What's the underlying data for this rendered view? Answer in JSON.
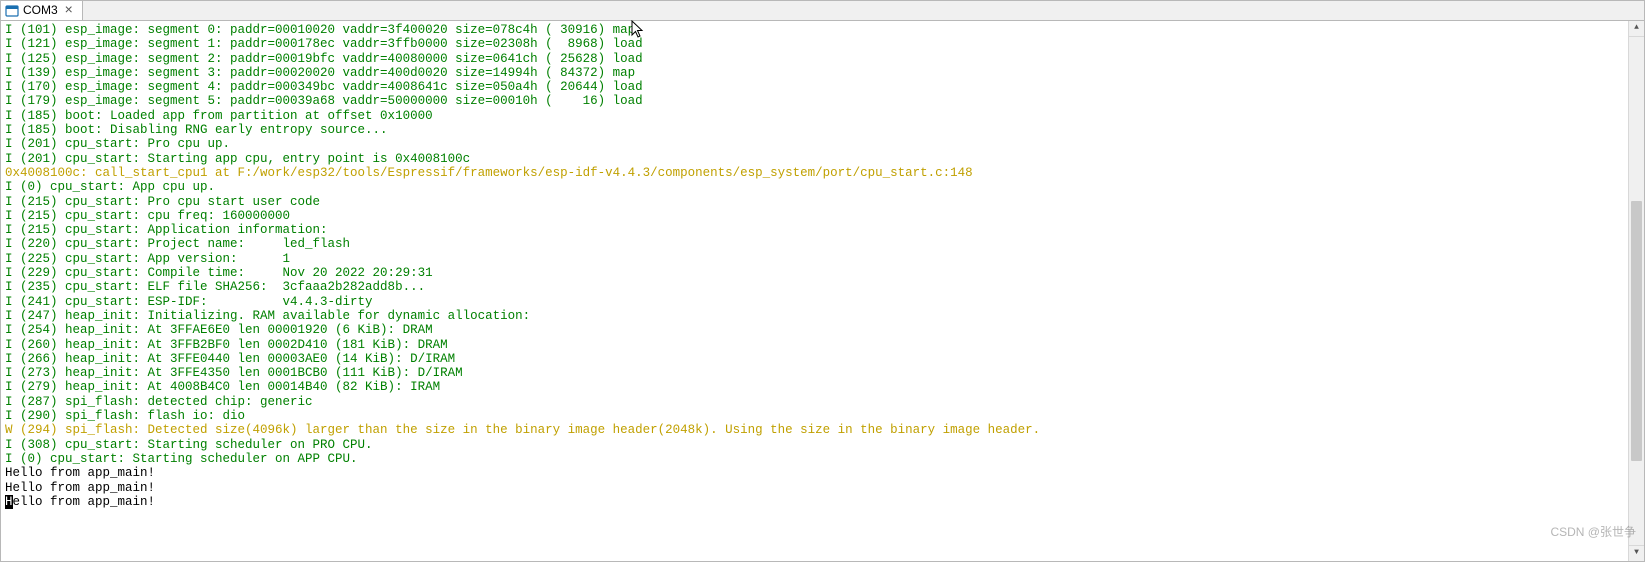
{
  "tab": {
    "label": "COM3",
    "iconName": "terminal-icon"
  },
  "lines": [
    {
      "cls": "c-green",
      "text": "I (101) esp_image: segment 0: paddr=00010020 vaddr=3f400020 size=078c4h ( 30916) map"
    },
    {
      "cls": "c-green",
      "text": "I (121) esp_image: segment 1: paddr=000178ec vaddr=3ffb0000 size=02308h (  8968) load"
    },
    {
      "cls": "c-green",
      "text": "I (125) esp_image: segment 2: paddr=00019bfc vaddr=40080000 size=0641ch ( 25628) load"
    },
    {
      "cls": "c-green",
      "text": "I (139) esp_image: segment 3: paddr=00020020 vaddr=400d0020 size=14994h ( 84372) map"
    },
    {
      "cls": "c-green",
      "text": "I (170) esp_image: segment 4: paddr=000349bc vaddr=4008641c size=050a4h ( 20644) load"
    },
    {
      "cls": "c-green",
      "text": "I (179) esp_image: segment 5: paddr=00039a68 vaddr=50000000 size=00010h (    16) load"
    },
    {
      "cls": "c-green",
      "text": "I (185) boot: Loaded app from partition at offset 0x10000"
    },
    {
      "cls": "c-green",
      "text": "I (185) boot: Disabling RNG early entropy source..."
    },
    {
      "cls": "c-green",
      "text": "I (201) cpu_start: Pro cpu up."
    },
    {
      "cls": "c-green",
      "text": "I (201) cpu_start: Starting app cpu, entry point is 0x4008100c"
    },
    {
      "cls": "c-yellow",
      "text": "0x4008100c: call_start_cpu1 at F:/work/esp32/tools/Espressif/frameworks/esp-idf-v4.4.3/components/esp_system/port/cpu_start.c:148"
    },
    {
      "cls": "c-black",
      "text": ""
    },
    {
      "cls": "c-green",
      "text": "I (0) cpu_start: App cpu up."
    },
    {
      "cls": "c-green",
      "text": "I (215) cpu_start: Pro cpu start user code"
    },
    {
      "cls": "c-green",
      "text": "I (215) cpu_start: cpu freq: 160000000"
    },
    {
      "cls": "c-green",
      "text": "I (215) cpu_start: Application information:"
    },
    {
      "cls": "c-green",
      "text": "I (220) cpu_start: Project name:     led_flash"
    },
    {
      "cls": "c-green",
      "text": "I (225) cpu_start: App version:      1"
    },
    {
      "cls": "c-green",
      "text": "I (229) cpu_start: Compile time:     Nov 20 2022 20:29:31"
    },
    {
      "cls": "c-green",
      "text": "I (235) cpu_start: ELF file SHA256:  3cfaaa2b282add8b..."
    },
    {
      "cls": "c-green",
      "text": "I (241) cpu_start: ESP-IDF:          v4.4.3-dirty"
    },
    {
      "cls": "c-green",
      "text": "I (247) heap_init: Initializing. RAM available for dynamic allocation:"
    },
    {
      "cls": "c-green",
      "text": "I (254) heap_init: At 3FFAE6E0 len 00001920 (6 KiB): DRAM"
    },
    {
      "cls": "c-green",
      "text": "I (260) heap_init: At 3FFB2BF0 len 0002D410 (181 KiB): DRAM"
    },
    {
      "cls": "c-green",
      "text": "I (266) heap_init: At 3FFE0440 len 00003AE0 (14 KiB): D/IRAM"
    },
    {
      "cls": "c-green",
      "text": "I (273) heap_init: At 3FFE4350 len 0001BCB0 (111 KiB): D/IRAM"
    },
    {
      "cls": "c-green",
      "text": "I (279) heap_init: At 4008B4C0 len 00014B40 (82 KiB): IRAM"
    },
    {
      "cls": "c-green",
      "text": "I (287) spi_flash: detected chip: generic"
    },
    {
      "cls": "c-green",
      "text": "I (290) spi_flash: flash io: dio"
    },
    {
      "cls": "c-yellow",
      "text": "W (294) spi_flash: Detected size(4096k) larger than the size in the binary image header(2048k). Using the size in the binary image header."
    },
    {
      "cls": "c-green",
      "text": "I (308) cpu_start: Starting scheduler on PRO CPU."
    },
    {
      "cls": "c-green",
      "text": "I (0) cpu_start: Starting scheduler on APP CPU."
    },
    {
      "cls": "c-black",
      "text": "Hello from app_main!"
    },
    {
      "cls": "c-black",
      "text": "Hello from app_main!"
    }
  ],
  "lastLine": {
    "cursorChar": "H",
    "rest": "ello from app_main!"
  },
  "watermark": "CSDN @张世争"
}
